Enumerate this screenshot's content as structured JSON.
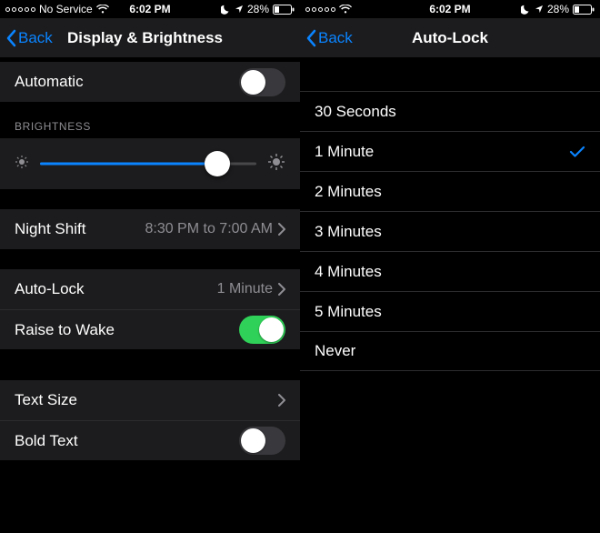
{
  "status": {
    "carrier": "No Service",
    "time": "6:02 PM",
    "battery_pct": "28%"
  },
  "left": {
    "back": "Back",
    "title": "Display & Brightness",
    "automatic": {
      "label": "Automatic",
      "on": false
    },
    "brightness_header": "BRIGHTNESS",
    "brightness_pct": 82,
    "night_shift": {
      "label": "Night Shift",
      "detail": "8:30 PM to 7:00 AM"
    },
    "auto_lock": {
      "label": "Auto-Lock",
      "detail": "1 Minute"
    },
    "raise_to_wake": {
      "label": "Raise to Wake",
      "on": true
    },
    "text_size": {
      "label": "Text Size"
    },
    "bold_text": {
      "label": "Bold Text",
      "on": false
    }
  },
  "right": {
    "back": "Back",
    "title": "Auto-Lock",
    "options": [
      {
        "label": "30 Seconds",
        "selected": false
      },
      {
        "label": "1 Minute",
        "selected": true
      },
      {
        "label": "2 Minutes",
        "selected": false
      },
      {
        "label": "3 Minutes",
        "selected": false
      },
      {
        "label": "4 Minutes",
        "selected": false
      },
      {
        "label": "5 Minutes",
        "selected": false
      },
      {
        "label": "Never",
        "selected": false
      }
    ]
  },
  "colors": {
    "accent": "#0a84ff",
    "toggle_on": "#30d158"
  }
}
